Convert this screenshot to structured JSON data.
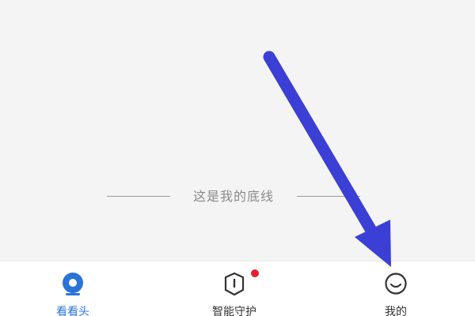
{
  "content": {
    "end_of_list_text": "这是我的底线"
  },
  "tab_bar": {
    "tabs": [
      {
        "label": "看看头",
        "icon": "camera-lens-icon",
        "active": true
      },
      {
        "label": "智能守护",
        "icon": "shield-icon",
        "active": false,
        "has_badge": true
      },
      {
        "label": "我的",
        "icon": "profile-icon",
        "active": false
      }
    ]
  },
  "annotation": {
    "arrow_color": "#3b3fd6",
    "points_to": "我的"
  },
  "colors": {
    "accent": "#2a74d8",
    "badge": "#e8202a",
    "background": "#f4f4f4"
  }
}
